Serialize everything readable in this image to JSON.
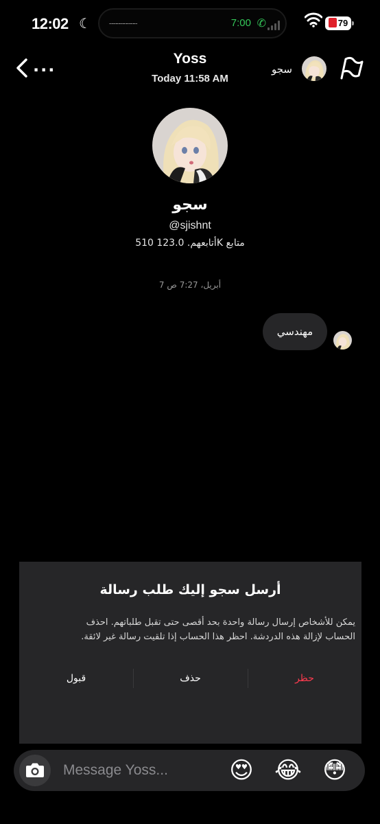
{
  "status_bar": {
    "time": "12:02",
    "island_time": "7:00",
    "battery": "79"
  },
  "header": {
    "title": "Yoss",
    "subtitle": "Today 11:58 AM",
    "contact_name": "سجو"
  },
  "profile": {
    "name": "سجو",
    "handle": "@sjishnt",
    "stats": "510 أتابعهم. 123.0K متابع"
  },
  "conversation": {
    "date_stamp": "7 أبريل، 7:27 ص",
    "messages": [
      {
        "text": "مهندسي"
      }
    ]
  },
  "request_panel": {
    "title": "أرسل سجو إليك طلب رسالة",
    "body": "يمكن للأشخاص إرسال رسالة واحدة بحد أقصى حتى تقبل طلباتهم. احذف الحساب لإزالة هذه الدردشة. احظر هذا الحساب إذا تلقيت رسالة غير لائقة.",
    "accept_label": "قبول",
    "delete_label": "حذف",
    "block_label": "حظر",
    "block_color": "#ff3b4f"
  },
  "composer": {
    "placeholder": "Message Yoss...",
    "quick_emojis": [
      "😍",
      "😂",
      "😳"
    ]
  }
}
